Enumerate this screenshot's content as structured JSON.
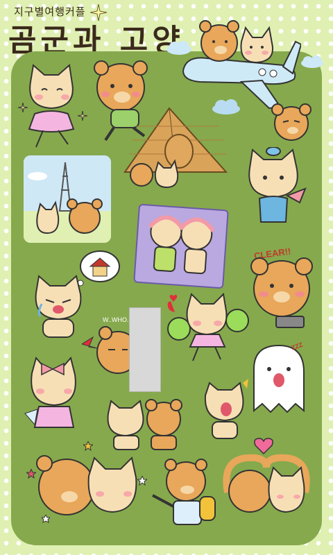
{
  "header": {
    "subtitle": "지구별여행커플",
    "title": "곰군과 고양"
  },
  "stickers": {
    "clear_label": "CLEAR!!",
    "who_label": "W..WHO..?",
    "zzz_label": "ZZZ"
  },
  "colors": {
    "background": "#dff0b2",
    "panel": "#86a94d",
    "bear": "#e8a75a",
    "cat": "#f7dfb5"
  }
}
